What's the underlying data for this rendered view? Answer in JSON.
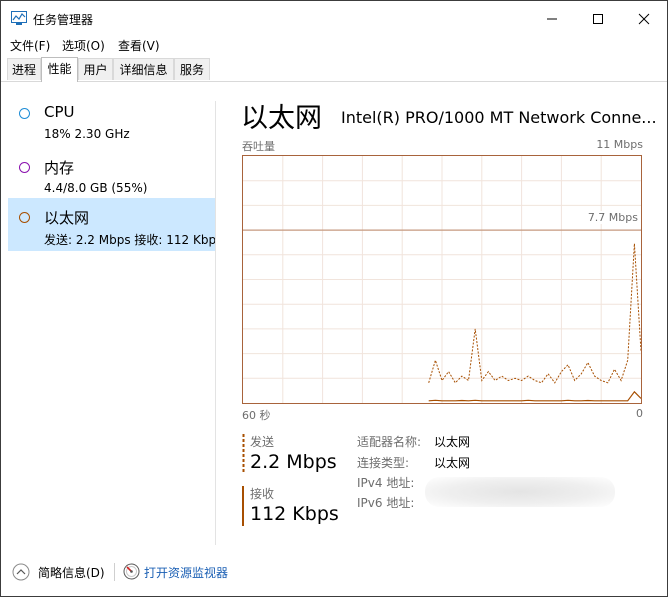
{
  "window": {
    "title": "任务管理器"
  },
  "titlebar_buttons": {
    "minimize_icon": "minimize-icon",
    "maximize_icon": "maximize-icon",
    "close_icon": "close-icon"
  },
  "menu": [
    "文件(F)",
    "选项(O)",
    "查看(V)"
  ],
  "tabs": [
    "进程",
    "性能",
    "用户",
    "详细信息",
    "服务"
  ],
  "active_tab": "性能",
  "resources": [
    {
      "name": "CPU",
      "value": "18% 2.30 GHz",
      "color": "#1f8dd6"
    },
    {
      "name": "内存",
      "value": "4.4/8.0 GB (55%)",
      "color": "#8b12ae"
    },
    {
      "name": "以太网",
      "value": "发送: 2.2 Mbps 接收: 112 Kbps",
      "color": "#a74f01",
      "selected": true
    }
  ],
  "detail": {
    "title": "以太网",
    "adapter": "Intel(R) PRO/1000 MT Network Conne...",
    "throughput_label": "吞吐量",
    "max_label": "11 Mbps",
    "ref_line_label": "7.7 Mbps",
    "x_left": "60 秒",
    "x_right": "0",
    "accent_color": "#a74f01",
    "send_label": "发送",
    "send_value": "2.2 Mbps",
    "recv_label": "接收",
    "recv_value": "112 Kbps",
    "props": [
      {
        "label": "适配器名称:",
        "value": "以太网"
      },
      {
        "label": "连接类型:",
        "value": "以太网"
      },
      {
        "label": "IPv4 地址:",
        "value": ""
      },
      {
        "label": "IPv6 地址:",
        "value": ""
      }
    ]
  },
  "chart_data": {
    "type": "line",
    "ylim": [
      0,
      11
    ],
    "xlim": [
      60,
      0
    ],
    "x": [
      60,
      59,
      58,
      57,
      56,
      55,
      54,
      53,
      52,
      51,
      50,
      49,
      48,
      47,
      46,
      45,
      44,
      43,
      42,
      41,
      40,
      39,
      38,
      37,
      36,
      35,
      34,
      33,
      32,
      31,
      30,
      29,
      28,
      27,
      26,
      25,
      24,
      23,
      22,
      21,
      20,
      19,
      18,
      17,
      16,
      15,
      14,
      13,
      12,
      11,
      10,
      9,
      8,
      7,
      6,
      5,
      4,
      3,
      2,
      1,
      0
    ],
    "series": [
      {
        "values": [
          0,
          0,
          0,
          0,
          0,
          0,
          0,
          0,
          0,
          0,
          0,
          0,
          0,
          0,
          0,
          0,
          0,
          0,
          0,
          0,
          0,
          0,
          0,
          0,
          0,
          0,
          0,
          0,
          0.9,
          1.9,
          1.0,
          1.4,
          0.9,
          1.2,
          1.0,
          3.3,
          1.0,
          1.4,
          1.0,
          1.2,
          1.0,
          1.1,
          1.0,
          1.2,
          1.0,
          0.9,
          1.3,
          0.9,
          1.4,
          1.7,
          1.0,
          1.3,
          1.8,
          1.2,
          1.0,
          0.9,
          1.5,
          1.0,
          1.9,
          7.1,
          2.3,
          2.2
        ]
      },
      {
        "values": [
          0,
          0,
          0,
          0,
          0,
          0,
          0,
          0,
          0,
          0,
          0,
          0,
          0,
          0,
          0,
          0,
          0,
          0,
          0,
          0,
          0,
          0,
          0,
          0,
          0,
          0,
          0,
          0,
          0.1,
          0.12,
          0.1,
          0.1,
          0.1,
          0.11,
          0.1,
          0.12,
          0.1,
          0.1,
          0.1,
          0.1,
          0.1,
          0.1,
          0.1,
          0.12,
          0.1,
          0.1,
          0.1,
          0.1,
          0.1,
          0.12,
          0.1,
          0.1,
          0.11,
          0.1,
          0.1,
          0.1,
          0.1,
          0.1,
          0.1,
          0.5,
          0.2,
          0.1
        ]
      }
    ],
    "reference_line": 7.7,
    "grid": true
  },
  "footer": {
    "summary_label": "简略信息(D)",
    "monitor_label": "打开资源监视器"
  }
}
